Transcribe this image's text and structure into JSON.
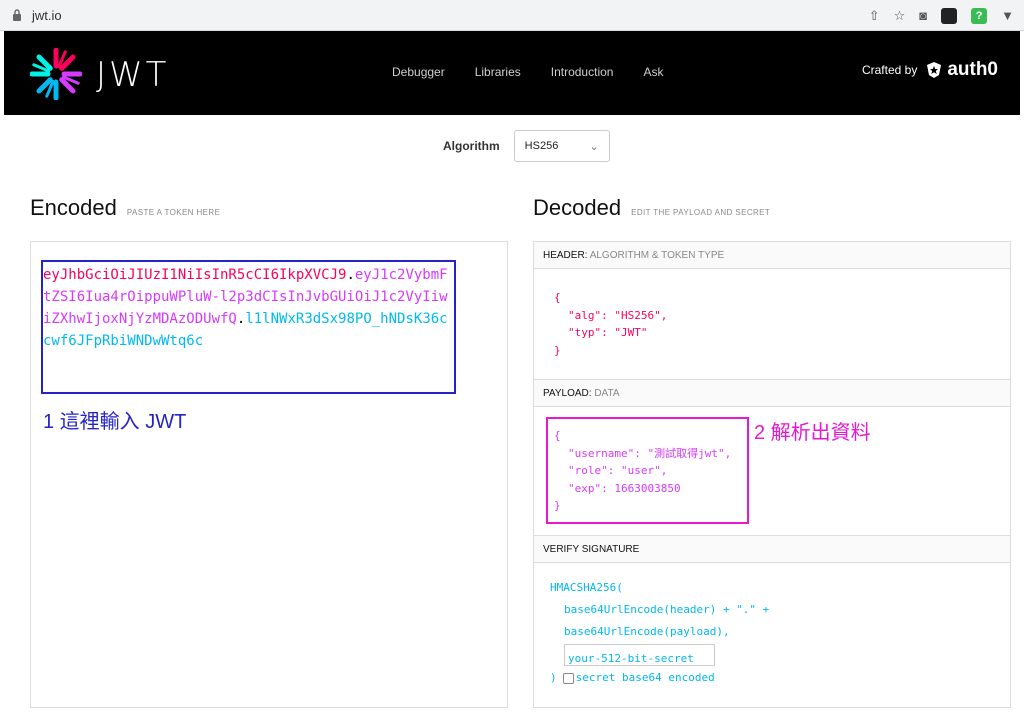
{
  "browser": {
    "url": "jwt.io"
  },
  "header": {
    "logo_text": "JWT",
    "nav": [
      "Debugger",
      "Libraries",
      "Introduction",
      "Ask"
    ],
    "crafted_by": "Crafted by",
    "brand": "auth0"
  },
  "algorithm": {
    "label": "Algorithm",
    "selected": "HS256"
  },
  "encoded": {
    "title": "Encoded",
    "subtitle": "PASTE A TOKEN HERE",
    "token_header": "eyJhbGciOiJIUzI1NiIsInR5cCI6IkpXVCJ9",
    "token_payload": "eyJ1c2VybmFtZSI6Iua4rOippuWPluW-l2p3dCIsInJvbGUiOiJ1c2VyIiwiZXhwIjoxNjYzMDAzODUwfQ",
    "token_signature": "l1lNWxR3dSx98PO_hNDsK36ccwf6JFpRbiWNDwWtq6c",
    "annotation": "1 這裡輸入 JWT"
  },
  "decoded": {
    "title": "Decoded",
    "subtitle": "EDIT THE PAYLOAD AND SECRET",
    "header_section": {
      "label": "HEADER:",
      "sub": "ALGORITHM & TOKEN TYPE",
      "open": "{",
      "alg_key": "\"alg\"",
      "alg_val": "\"HS256\",",
      "typ_key": "\"typ\"",
      "typ_val": "\"JWT\"",
      "close": "}"
    },
    "payload_section": {
      "label": "PAYLOAD:",
      "sub": "DATA",
      "open": "{",
      "username_key": "\"username\"",
      "username_val": "\"測試取得jwt\",",
      "role_key": "\"role\"",
      "role_val": "\"user\",",
      "exp_key": "\"exp\"",
      "exp_val": "1663003850",
      "close": "}",
      "annotation": "2 解析出資料"
    },
    "signature_section": {
      "label": "VERIFY SIGNATURE",
      "line1": "HMACSHA256(",
      "line2": "base64UrlEncode(header) + \".\" +",
      "line3": "base64UrlEncode(payload),",
      "secret_placeholder": "your-512-bit-secret",
      "close": ")",
      "checkbox_label": "secret base64 encoded"
    }
  },
  "colors": {
    "header_red": "#fb015b",
    "payload_purple": "#d63aff",
    "signature_blue": "#00b9f1",
    "annotation_blue": "#2323c8",
    "annotation_magenta": "#e619d2"
  }
}
